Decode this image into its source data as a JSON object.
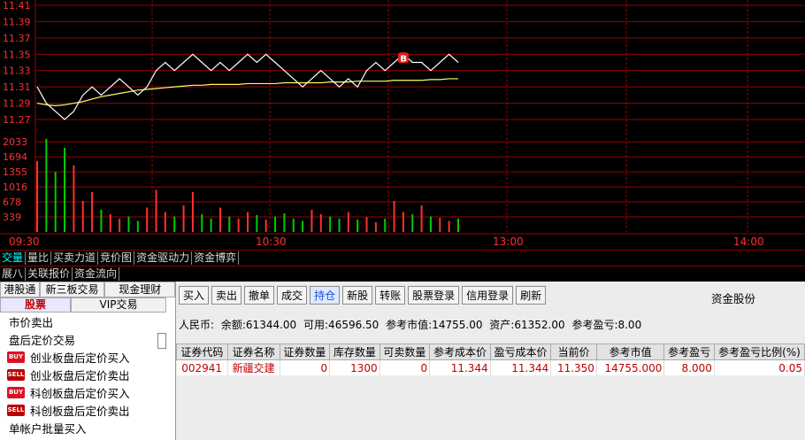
{
  "chart": {
    "price_ticks": [
      "11.41",
      "11.39",
      "11.37",
      "11.35",
      "11.33",
      "11.31",
      "11.29",
      "11.27"
    ],
    "volume_ticks": [
      "2033",
      "1694",
      "1355",
      "1016",
      "678",
      "339"
    ],
    "time_ticks": [
      "09:30",
      "10:30",
      "13:00",
      "14:00"
    ],
    "buy_marker": "B",
    "colors": {
      "grid": "#9a0000",
      "price": "#ffffff",
      "avg": "#ffff66",
      "up": "#ff3030",
      "down": "#00cc00",
      "axis_text": "#ff3030",
      "time_text": "#ff3030"
    }
  },
  "chart_data": {
    "type": "line",
    "price_series": [
      11.31,
      11.29,
      11.28,
      11.27,
      11.28,
      11.3,
      11.31,
      11.3,
      11.31,
      11.32,
      11.31,
      11.3,
      11.31,
      11.33,
      11.34,
      11.33,
      11.34,
      11.35,
      11.34,
      11.33,
      11.34,
      11.33,
      11.34,
      11.35,
      11.34,
      11.35,
      11.34,
      11.33,
      11.32,
      11.31,
      11.32,
      11.33,
      11.32,
      11.31,
      11.32,
      11.31,
      11.33,
      11.34,
      11.33,
      11.34,
      11.35,
      11.34,
      11.34,
      11.33,
      11.34,
      11.35,
      11.34
    ],
    "avg_series": [
      11.29,
      11.288,
      11.287,
      11.288,
      11.29,
      11.292,
      11.295,
      11.298,
      11.3,
      11.302,
      11.304,
      11.306,
      11.307,
      11.308,
      11.309,
      11.31,
      11.311,
      11.312,
      11.312,
      11.313,
      11.313,
      11.313,
      11.313,
      11.314,
      11.314,
      11.314,
      11.314,
      11.315,
      11.315,
      11.315,
      11.315,
      11.315,
      11.316,
      11.316,
      11.316,
      11.317,
      11.317,
      11.317,
      11.317,
      11.318,
      11.318,
      11.318,
      11.318,
      11.319,
      11.319,
      11.32,
      11.32
    ],
    "volume": [
      1600,
      2100,
      1350,
      1900,
      1500,
      700,
      900,
      500,
      400,
      300,
      350,
      250,
      550,
      950,
      450,
      350,
      600,
      900,
      400,
      300,
      550,
      350,
      300,
      450,
      380,
      280,
      350,
      420,
      300,
      250,
      500,
      400,
      350,
      300,
      450,
      280,
      330,
      220,
      300,
      700,
      450,
      400,
      600,
      350,
      320,
      250,
      300
    ]
  },
  "tabs_row1": [
    "交量",
    "量比",
    "买卖力道",
    "竞价图",
    "资金驱动力",
    "资金博弈"
  ],
  "tabs_row2": [
    "展八",
    "关联报价",
    "资金流向"
  ],
  "left_tabs": [
    "港股通",
    "新三板交易",
    "现金理财"
  ],
  "left_subtabs": [
    "股票",
    "VIP交易"
  ],
  "menu": [
    {
      "label": "市价卖出",
      "badge": ""
    },
    {
      "label": "盘后定价交易",
      "badge": ""
    },
    {
      "label": "创业板盘后定价买入",
      "badge": "BUY"
    },
    {
      "label": "创业板盘后定价卖出",
      "badge": "SELL"
    },
    {
      "label": "科创板盘后定价买入",
      "badge": "BUY"
    },
    {
      "label": "科创板盘后定价卖出",
      "badge": "SELL"
    },
    {
      "label": "单帐户批量买入",
      "badge": ""
    }
  ],
  "toolbar": [
    "买入",
    "卖出",
    "撤单",
    "成交",
    "持仓",
    "新股",
    "转账",
    "股票登录",
    "信用登录",
    "刷新"
  ],
  "toolbar_active": "持仓",
  "account_title": "资金股份",
  "summary": {
    "currency": "人民币:",
    "balance": "余额:61344.00",
    "available": "可用:46596.50",
    "market_value": "参考市值:14755.00",
    "assets": "资产:61352.00",
    "pnl": "参考盈亏:8.00"
  },
  "table": {
    "headers": [
      "证券代码",
      "证券名称",
      "证券数量",
      "库存数量",
      "可卖数量",
      "参考成本价",
      "盈亏成本价",
      "当前价",
      "参考市值",
      "参考盈亏",
      "参考盈亏比例(%)"
    ],
    "rows": [
      [
        "002941",
        "新疆交建",
        "0",
        "1300",
        "0",
        "11.344",
        "11.344",
        "11.350",
        "14755.000",
        "8.000",
        "0.05"
      ]
    ]
  }
}
